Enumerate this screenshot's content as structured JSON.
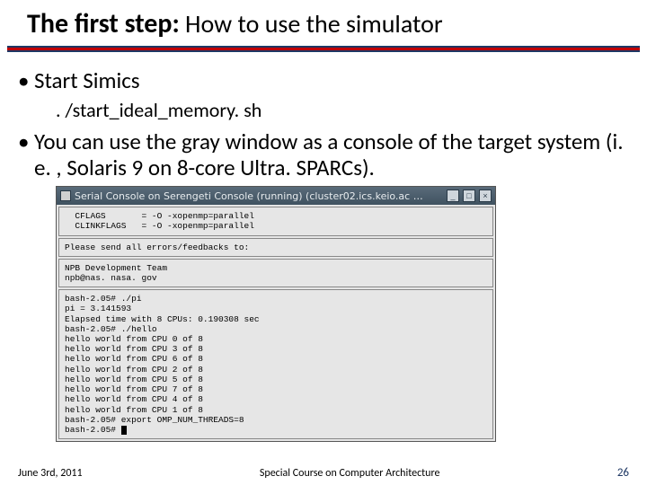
{
  "title": {
    "bold": "The first step:",
    "rest": " How to use the simulator"
  },
  "bullets": {
    "b1": "Start Simics",
    "cmd": ". /start_ideal_memory. sh",
    "b2": "You can use the gray window as a console of the target system (i. e. , Solaris 9 on 8-core Ultra. SPARCs)."
  },
  "terminal": {
    "titlebar": "Serial Console on Serengeti Console (running) (cluster02.ics.keio.ac …",
    "buttons": {
      "min": "_",
      "max": "□",
      "close": "×"
    },
    "block1": "  CFLAGS       = -O -xopenmp=parallel\n  CLINKFLAGS   = -O -xopenmp=parallel",
    "block2": "Please send all errors/feedbacks to:",
    "block3": "NPB Development Team\nnpb@nas. nasa. gov",
    "block4": "bash-2.05# ./pi\npi = 3.141593\nElapsed time with 8 CPUs: 0.190308 sec\nbash-2.05# ./hello\nhello world from CPU 0 of 8\nhello world from CPU 3 of 8\nhello world from CPU 6 of 8\nhello world from CPU 2 of 8\nhello world from CPU 5 of 8\nhello world from CPU 7 of 8\nhello world from CPU 4 of 8\nhello world from CPU 1 of 8\nbash-2.05# export OMP_NUM_THREADS=8\nbash-2.05# "
  },
  "footer": {
    "left": "June 3rd, 2011",
    "mid": "Special Course on Computer Architecture",
    "right": "26"
  }
}
